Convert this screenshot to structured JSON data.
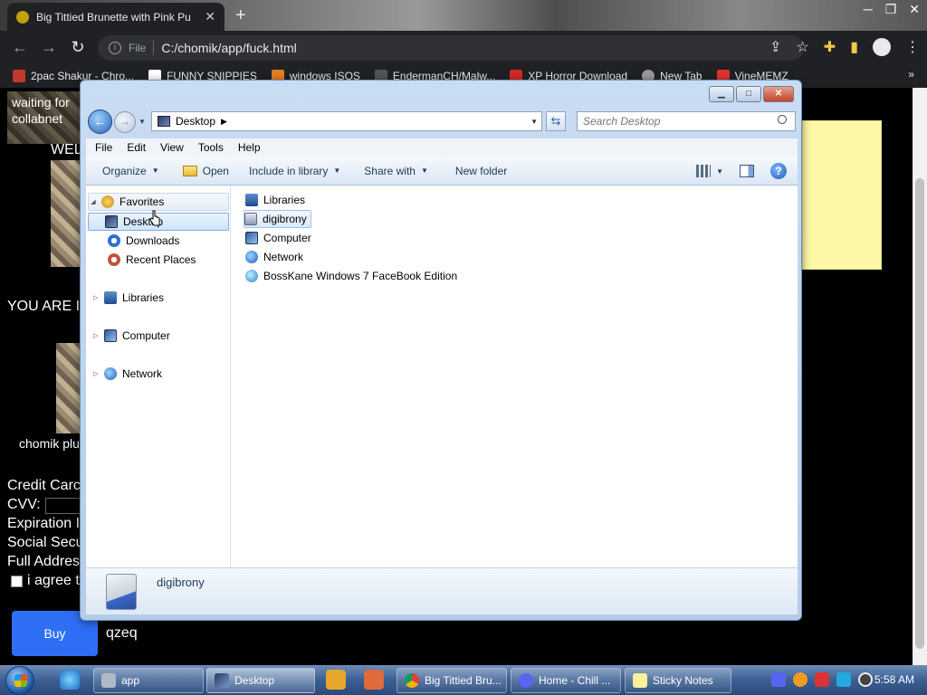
{
  "chrome": {
    "tab_title": "Big Tittied Brunette with Pink Pu",
    "url_label": "File",
    "url": "C:/chomik/app/fuck.html",
    "bookmarks": [
      {
        "label": "2pac Shakur - Chro..."
      },
      {
        "label": "FUNNY SNIPPIES"
      },
      {
        "label": "windows ISOS"
      },
      {
        "label": "EndermanCH/Malw..."
      },
      {
        "label": "XP Horror Download"
      },
      {
        "label": "New Tab"
      },
      {
        "label": "VineMEMZ"
      }
    ],
    "bookmarks_more": "»"
  },
  "webpage": {
    "waiting_line1": "waiting for",
    "waiting_line2": "collabnet",
    "welcome": "WEL",
    "you_are": "YOU ARE I",
    "caption": "chomik plu",
    "credit": "Credit Carc",
    "cvv": "CVV:",
    "expiration": "Expiration I",
    "social": "Social Secu",
    "address": "Full Addres",
    "agree": "i agree t",
    "buy": "Buy",
    "random": "qzeq"
  },
  "explorer": {
    "address": "Desktop",
    "search_placeholder": "Search Desktop",
    "menu": [
      "File",
      "Edit",
      "View",
      "Tools",
      "Help"
    ],
    "commands": {
      "organize": "Organize",
      "open": "Open",
      "include": "Include in library",
      "share": "Share with",
      "new_folder": "New folder"
    },
    "nav": {
      "favorites": "Favorites",
      "desktop": "Desktop",
      "downloads": "Downloads",
      "recent": "Recent Places",
      "libraries": "Libraries",
      "computer": "Computer",
      "network": "Network"
    },
    "items": [
      {
        "label": "Libraries"
      },
      {
        "label": "digibrony"
      },
      {
        "label": "Computer"
      },
      {
        "label": "Network"
      },
      {
        "label": "BossKane Windows 7 FaceBook Edition"
      }
    ],
    "details_name": "digibrony"
  },
  "taskbar": {
    "tasks": [
      {
        "label": "app"
      },
      {
        "label": "Desktop"
      },
      {
        "label": "Big Tittied Bru..."
      },
      {
        "label": "Home - Chill ..."
      },
      {
        "label": "Sticky Notes"
      }
    ],
    "clock": "5:58 AM"
  }
}
